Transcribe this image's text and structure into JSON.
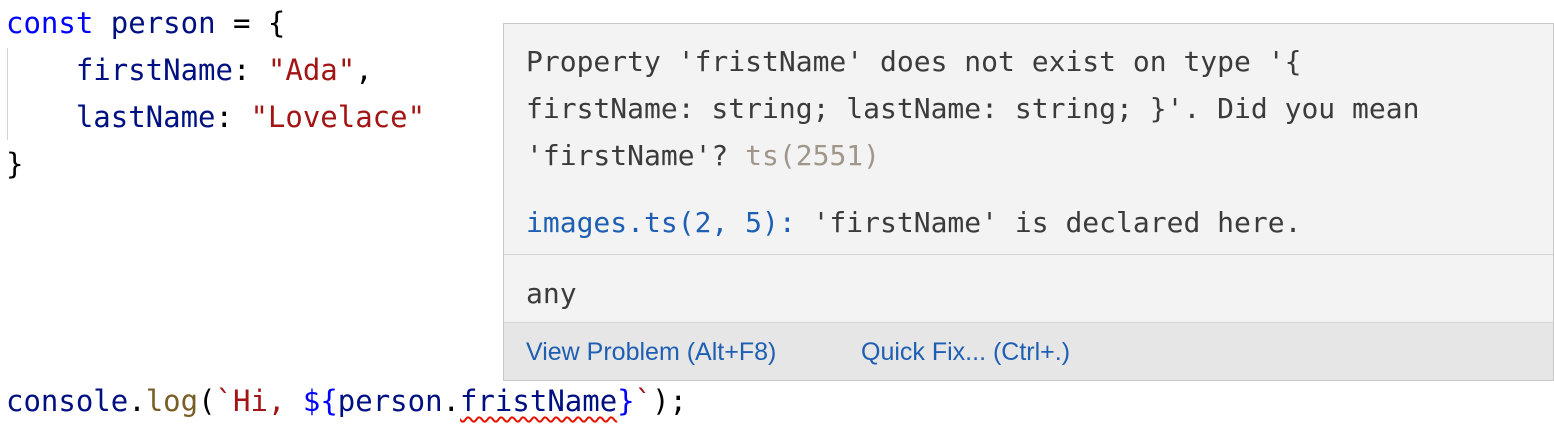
{
  "code": {
    "line1": {
      "kw": "const",
      "name": "person",
      "op": " = {"
    },
    "line2": {
      "key": "firstName",
      "colon": ": ",
      "value": "\"Ada\"",
      "comma": ","
    },
    "line3": {
      "key": "lastName",
      "colon": ": ",
      "value": "\"Lovelace\""
    },
    "line4": {
      "brace": "}"
    },
    "line6": {
      "obj": "console",
      "dot1": ".",
      "fn": "log",
      "open": "(",
      "tpl_start": "`Hi, ",
      "interp_open": "${",
      "ref": "person",
      "dot2": ".",
      "error_prop": "fristName",
      "interp_close": "}",
      "tpl_end": "`",
      "close": ");"
    }
  },
  "hover": {
    "message_line1": "Property 'fristName' does not exist on type '{",
    "message_line2": "firstName: string; lastName: string; }'. Did you mean",
    "message_line3": "'firstName'? ",
    "error_code": "ts(2551)",
    "related_location": "images.ts(2, 5):",
    "related_text": " 'firstName' is declared here.",
    "type": "any",
    "actions": {
      "view_problem": "View Problem (Alt+F8)",
      "quick_fix": "Quick Fix... (Ctrl+.)"
    }
  },
  "colors": {
    "keyword": "#0000ff",
    "variable": "#001080",
    "string": "#a31515",
    "error_squiggle": "#e51400",
    "link": "#1e5fb3"
  }
}
